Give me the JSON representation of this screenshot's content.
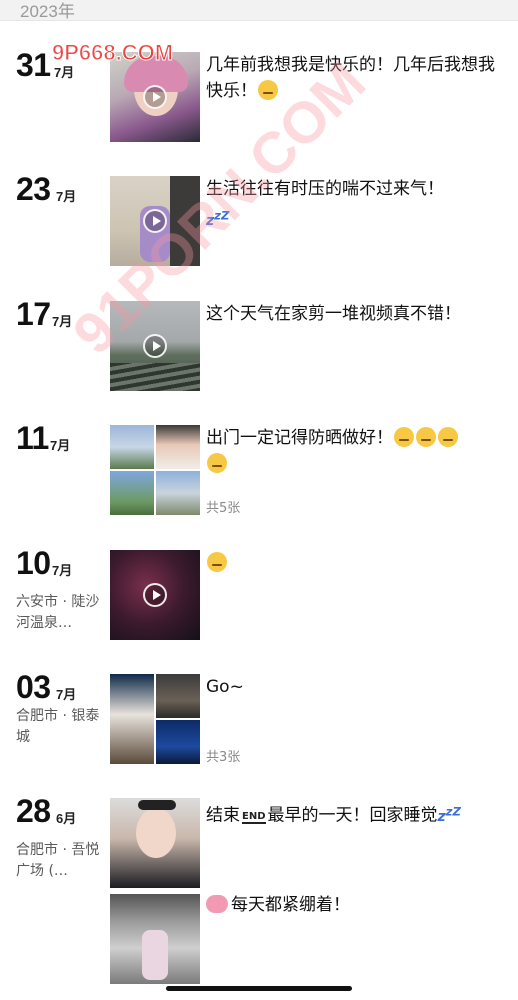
{
  "header": {
    "year": "2023年"
  },
  "watermarks": {
    "top": "9P668.COM",
    "diagonal": "91PORN.COM"
  },
  "entries": [
    {
      "day": "31",
      "month": "7月",
      "text": "几年前我想我是快乐的！几年后我想我快乐！",
      "emoji_after": "pensive-emoji",
      "media": "video"
    },
    {
      "day": "23",
      "month": "7月",
      "text": "生活往往有时压的喘不过来气！",
      "extra": "zzz",
      "media": "video"
    },
    {
      "day": "17",
      "month": "7月",
      "text": "这个天气在家剪一堆视频真不错！",
      "media": "video"
    },
    {
      "day": "11",
      "month": "7月",
      "text": "出门一定记得防晒做好！",
      "emojis": [
        "pensive-emoji",
        "pensive-emoji",
        "pensive-emoji",
        "pensive-emoji"
      ],
      "count": "共5张",
      "media": "grid4"
    },
    {
      "day": "10",
      "month": "7月",
      "location": "六安市 · 陡沙河温泉…",
      "text": "",
      "emoji": "grinning-emoji",
      "media": "video"
    },
    {
      "day": "03",
      "month": "7月",
      "location": "合肥市 · 银泰城",
      "text": "Go~",
      "count": "共3张",
      "media": "grid3"
    },
    {
      "day": "28",
      "month": "6月",
      "location": "合肥市 · 吾悦广场 (…",
      "text_a": "结束",
      "end_sign": "END",
      "text_b": "最早的一天！回家睡觉",
      "extra": "zzz",
      "media": "photo"
    },
    {
      "text_pre_icon": "brain-icon",
      "text": "每天都紧绷着！",
      "media": "photo"
    }
  ],
  "colors": {
    "zzz": "#3a6ed8",
    "watermark": "#eb2828"
  }
}
